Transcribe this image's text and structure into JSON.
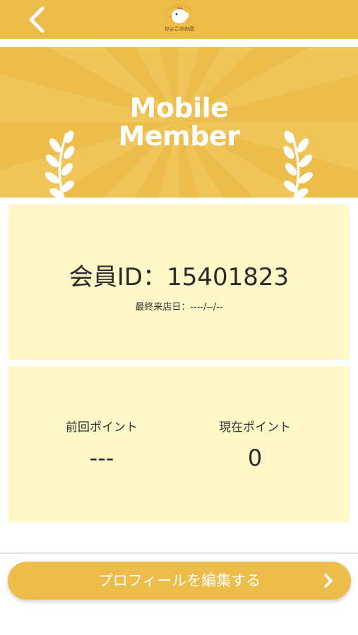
{
  "header": {
    "back_icon": "chevron-left-icon",
    "logo_icon": "chicken-logo-icon",
    "logo_text": "ひよこのお店"
  },
  "banner": {
    "title_line1": "Mobile",
    "title_line2": "Member",
    "left_icon": "laurel-branch-icon",
    "right_icon": "laurel-branch-icon"
  },
  "member": {
    "id_label": "会員ID：15401823",
    "last_visit": "最終来店日：----/--/--"
  },
  "points": {
    "previous_label": "前回ポイント",
    "previous_value": "---",
    "current_label": "現在ポイント",
    "current_value": "0"
  },
  "edit_button": {
    "label": "プロフィールを編集する",
    "icon": "chevron-right-icon"
  },
  "colors": {
    "primary": "#ecbb48",
    "card": "#fef7c7",
    "text": "#2a2a2a"
  }
}
